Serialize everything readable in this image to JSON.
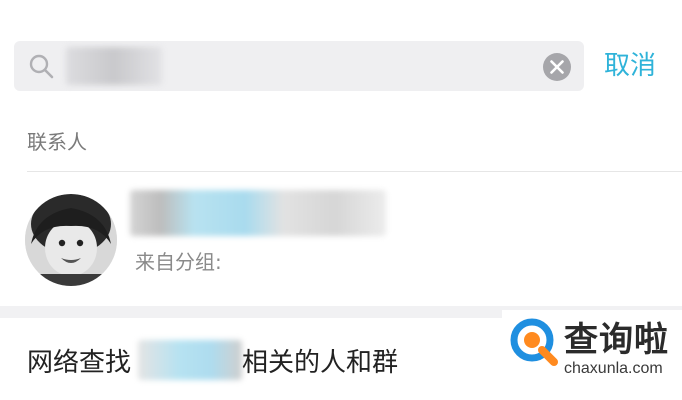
{
  "search": {
    "value": "",
    "placeholder": "",
    "cancel_label": "取消"
  },
  "contacts_section": {
    "label": "联系人"
  },
  "contact": {
    "name": "",
    "subtitle": "来自分组:"
  },
  "search_online": {
    "prefix": "网络查找",
    "suffix": "相关的人和群"
  },
  "watermark": {
    "title": "查询啦",
    "url": "chaxunla.com"
  },
  "colors": {
    "accent": "#2fb3d9",
    "search_bg": "#efeff1",
    "logo_blue": "#1f8fe0",
    "logo_orange": "#ff8a1f"
  }
}
